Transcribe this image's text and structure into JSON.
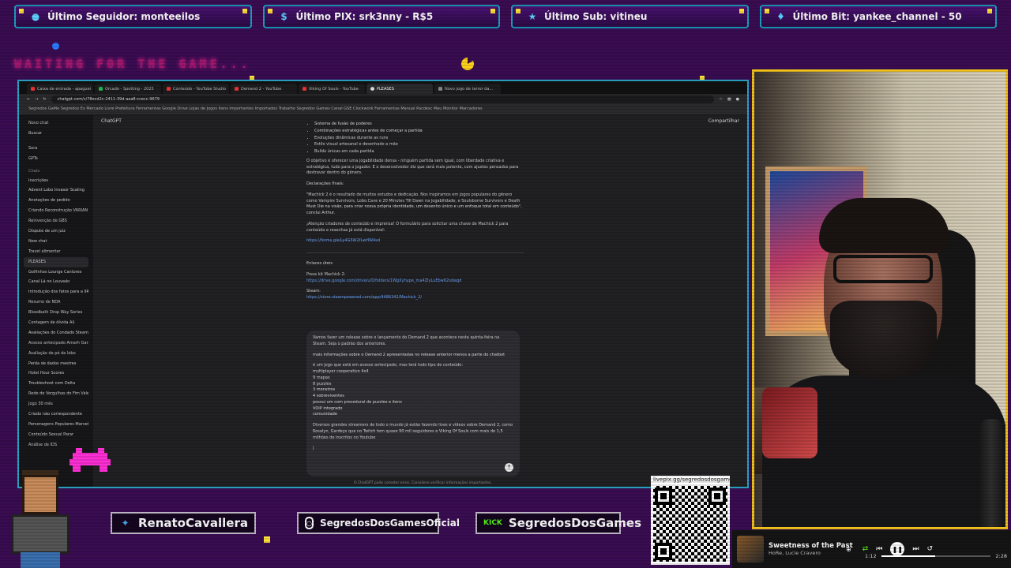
{
  "alerts": [
    {
      "icon": "user-icon",
      "text": "Último Seguidor: monteeilos"
    },
    {
      "icon": "dollar-icon",
      "text": "Último PIX: srk3nny - R$5"
    },
    {
      "icon": "star-icon",
      "text": "Último Sub: vitineu"
    },
    {
      "icon": "diamond-icon",
      "text": "Último Bit: yankee_channel - 50"
    }
  ],
  "waiting_text": "WAITING FOR THE GAME...",
  "browser": {
    "tabs": [
      "Caixa de entrada - apaguei",
      "Orcado - Spotting - 2025",
      "Conteúdo - YouTube Studio",
      "Demand 2 - YouTube",
      "Viking Of Souls - YouTube",
      "PLEASES",
      "Novo jogo de terror da..."
    ],
    "url": "chatgpt.com/c/78ecd2c-2411-39d-aaa8-ccecc-9679",
    "bookmarks": "Segredos GaMe   Segredos Ex   Mercado Livre   Prefeitura   Ferramentas   Google Drive   Lojas de Jogos   Itens Importantes   Importados   Trabalho   Segredos Games   Canal GSE   Clockwork   Ferramentas   Manual Pacdesc   Meu Monitor   Marcadores"
  },
  "chatgpt": {
    "model": "ChatGPT",
    "share": "Compartilhar",
    "sidebar_top": [
      "Novo chat",
      "Buscar"
    ],
    "sidebar_mid": [
      "Sora",
      "GPTs"
    ],
    "sidebar_heading": "Chats",
    "sidebar_items": [
      "Inscrições",
      "Advent Lobo Invasor Scaling",
      "Anotações de pedido",
      "Criando Reconstrução VARIAN",
      "Reinvenção de GBS",
      "Dispute de um juiz",
      "New chat",
      "Travel alimentar",
      "PLEASES",
      "Golfinhos Lounge Cantores",
      "Canal Lá no Louvado",
      "Introdução dos fatos para a IIR",
      "Resumo de NDA",
      "Bloodbath Drop Way Series",
      "Contagem de dívida Ali",
      "Avaliações do Condado Steam",
      "Acesso antecipado Amarh Garden",
      "Avaliação de pé de lobo",
      "Perda de dados mestres",
      "Hotel Hour Scores",
      "Troubleshoot com Delta",
      "Rede de Vergulhas do Fim Vale",
      "Jogo 30 mês",
      "Criado não correspondente",
      "Personagens Populares Marvel",
      "Conteúdo Sexual Parar",
      "Análise de IDS"
    ],
    "conversation": {
      "bullets": [
        "Sistema de fusão de poderes",
        "Combinações estratégicas antes de começar a partida",
        "Evoluções dinâmicas durante as runs",
        "Estilo visual artesanal e desenhado a mão",
        "Builds únicas em cada partida"
      ],
      "p1": "O objetivo é oferecer uma jogabilidade densa - ninguém partida sem igual, com liberdade criativa e estratégica, tudo para o jogador. E o desenvolvedor diz que será mais potente, com ajustes pensados para destravar dentro do gênero.",
      "h1": "Declarações finais:",
      "p2": "\"Machick 2 é o resultado de muitos estudos e dedicação. Nos inspiramos em jogos populares do gênero como Vampire Survivors, Lobo.Cave e 20 Minutes Till Dawn na jogabilidade, e Soulsborne Survivors e Death Must Die na visão, para criar nossa própria identidade, um desenho único e um enfoque total em conteúdo\", conclui Arthur.",
      "p3": "¡Atenção criadores de conteúdo e imprensa! O formulário para solicitar uma chave de Machick 2 para conteúdo e resenhas já está disponível:",
      "link1": "https://forms.gle/Ly4G5W2fLwHW4sd",
      "h2": "Enlaces úteis",
      "h3": "Press kit Machick 2:",
      "link2": "https://drive.google.com/drive/u/0/folders/1WgXyhype_ma4ZIyLuEbwK2sdwgd",
      "h4": "Steam:",
      "link3": "https://store.steampowered.com/app/4486342/Machick_2/"
    },
    "compose": {
      "p1": "Vamos fazer um release sobre o lançamento do Demand 2 que acontece nesta quinta-feira na Steam. Seja o padrão dos anteriores.",
      "p2": "mais informações sobre o Demand 2 apresentadas no release anterior menos a parte do chatbot",
      "list": [
        "é um jogo que está em acesso antecipado, mas terá todo tipo de conteúdo:",
        "multiplayer cooperativo 4x4",
        "9 mapas",
        "8 puzzles",
        "3 monstros",
        "4 sobreviventes",
        "possui um com procedural de puzzles e itens",
        "VOIP integrado",
        "comunidade"
      ],
      "p3": "Diversos grandes streamers de todo o mundo já estão fazendo lives e vídeos sobre Demand 2, como Rosalyn, Gardeys que no Twitch tem quase 90 mil seguidores e Viking Of Souls com mais de 1,5 milhões de inscritos no Youtube",
      "cursor": "|"
    },
    "footnote": "O ChatGPT pode cometer erros. Considere verificar informações importantes."
  },
  "social": {
    "twitter": "RenatoCavallera",
    "instagram": "SegredosDosGamesOficial",
    "kick_label": "KICK",
    "kick": "SegredosDosGames"
  },
  "qr_label": "livepix.gg/segredosdosgames",
  "player": {
    "title": "Sweetness of the Past",
    "artist": "HoRe, Lucie Cravero",
    "current": "1:12",
    "total": "2:28",
    "progress": 0.49
  },
  "colors": {
    "accent_border": "#2aa8c8",
    "cam_border": "#f1c21b",
    "background": "#3a0c52"
  }
}
